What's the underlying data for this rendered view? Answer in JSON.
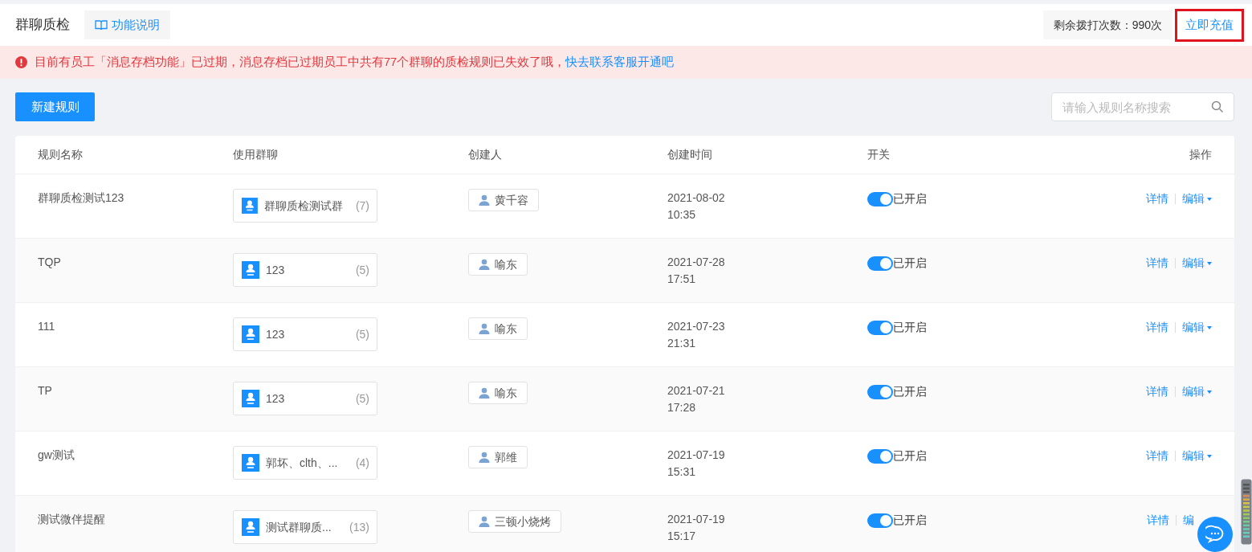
{
  "header": {
    "title": "群聊质检",
    "help_button": "功能说明",
    "balance": "剩余拨打次数：990次",
    "recharge_link": "立即充值",
    "recharge_highlighted": true
  },
  "alert": {
    "message": "目前有员工「消息存档功能」已过期，消息存档已过期员工中共有77个群聊的质检规则已失效了哦，",
    "link": "快去联系客服开通吧"
  },
  "toolbar": {
    "new_button": "新建规则",
    "search": {
      "placeholder": "请输入规则名称搜索"
    }
  },
  "table": {
    "columns": [
      "规则名称",
      "使用群聊",
      "创建人",
      "创建时间",
      "开关",
      "操作"
    ],
    "rows": [
      {
        "name": "群聊质检测试123",
        "group": "群聊质检测试群",
        "count": "(7)",
        "creator": "黄千容",
        "date": "2021-08-02",
        "time": "10:35",
        "on": true,
        "status": "已开启",
        "detail": "详情",
        "edit": "编辑",
        "dropdown": true
      },
      {
        "name": "TQP",
        "group": "123",
        "count": "(5)",
        "creator": "喻东",
        "date": "2021-07-28",
        "time": "17:51",
        "on": true,
        "status": "已开启",
        "detail": "详情",
        "edit": "编辑",
        "dropdown": true
      },
      {
        "name": "111",
        "group": "123",
        "count": "(5)",
        "creator": "喻东",
        "date": "2021-07-23",
        "time": "21:31",
        "on": true,
        "status": "已开启",
        "detail": "详情",
        "edit": "编辑",
        "dropdown": true
      },
      {
        "name": "TP",
        "group": "123",
        "count": "(5)",
        "creator": "喻东",
        "date": "2021-07-21",
        "time": "17:28",
        "on": true,
        "status": "已开启",
        "detail": "详情",
        "edit": "编辑",
        "dropdown": true
      },
      {
        "name": "gw测试",
        "group": "郭坏、clth、...",
        "count": "(4)",
        "creator": "郭维",
        "date": "2021-07-19",
        "time": "15:31",
        "on": true,
        "status": "已开启",
        "detail": "详情",
        "edit": "编辑",
        "dropdown": true
      },
      {
        "name": "测试微伴提醒",
        "group": "测试群聊质...",
        "count": "(13)",
        "creator": "三顿小烧烤",
        "date": "2021-07-19",
        "time": "15:17",
        "on": true,
        "status": "已开启",
        "detail": "详情",
        "edit": "编",
        "dropdown": false
      }
    ]
  }
}
